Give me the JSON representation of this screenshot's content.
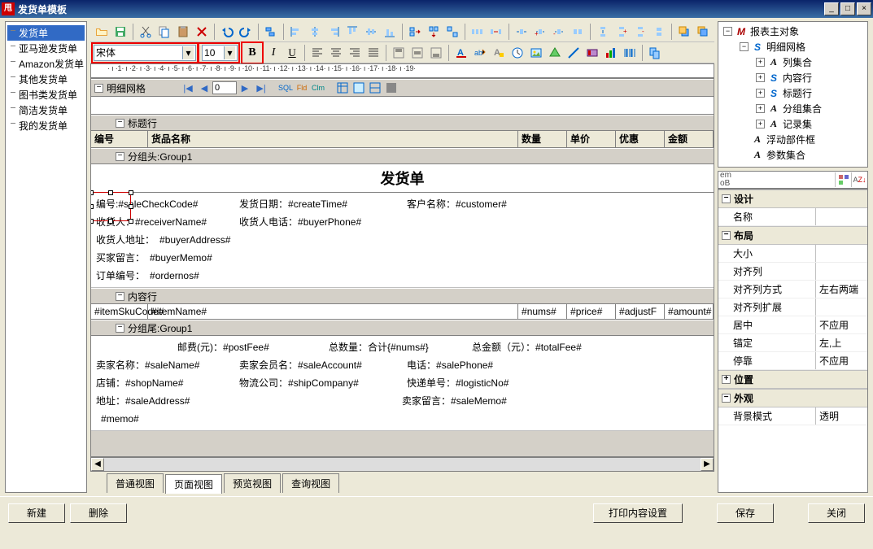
{
  "window": {
    "title": "发货单模板"
  },
  "leftTemplates": [
    "发货单",
    "亚马逊发货单",
    "Amazon发货单",
    "其他发货单",
    "图书类发货单",
    "简洁发货单",
    "我的发货单"
  ],
  "leftSelected": 0,
  "font": {
    "name": "宋体",
    "size": "10"
  },
  "rulerText": "· ı ·1· ı ·2· ı ·3· ı ·4· ı ·5· ı ·6· ı ·7· ı ·8· ı ·9· ı ·10· ı ·11· ı ·12· ı ·13· ı ·14· ı ·15· ı ·16· ı ·17· ı ·18· ı ·19·",
  "gridBar": {
    "label": "明细网格",
    "page": "0"
  },
  "sections": {
    "titleRow": "标题行",
    "groupHead": "分组头:Group1",
    "contentRow": "内容行",
    "groupFoot": "分组尾:Group1",
    "docTitle": "发货单"
  },
  "columns": {
    "no": "编号",
    "name": "货品名称",
    "qty": "数量",
    "price": "单价",
    "discount": "优惠",
    "amount": "金额"
  },
  "fields": {
    "line1": [
      {
        "label": "编号:",
        "val": "#saleCheckCode#"
      },
      {
        "label": "发货日期：",
        "val": "#createTime#"
      },
      {
        "label": "客户名称：",
        "val": "#customer#"
      }
    ],
    "line2": [
      {
        "label": "收货人：",
        "val": "#receiverName#"
      },
      {
        "label": "收货人电话：",
        "val": "#buyerPhone#"
      }
    ],
    "line3": [
      {
        "label": "收货人地址：",
        "val": "#buyerAddress#"
      }
    ],
    "line4": [
      {
        "label": "买家留言：",
        "val": "#buyerMemo#"
      }
    ],
    "line5": [
      {
        "label": "订单编号：",
        "val": "#ordernos#"
      }
    ],
    "content": [
      "#itemSkuCode#",
      "#itemName#",
      "#nums#",
      "#price#",
      "#adjustF",
      "#amount#"
    ],
    "foot1": [
      {
        "label": "邮费(元)：",
        "val": "#postFee#"
      },
      {
        "label": "总数量：",
        "val": "合计{#nums#}"
      },
      {
        "label": "总金额（元）：",
        "val": "#totalFee#"
      }
    ],
    "foot2": [
      {
        "label": "卖家名称：",
        "val": "#saleName#"
      },
      {
        "label": "卖家会员名：",
        "val": "#saleAccount#"
      },
      {
        "label": "电话：",
        "val": "#salePhone#"
      }
    ],
    "foot3": [
      {
        "label": "店铺：",
        "val": "#shopName#"
      },
      {
        "label": "物流公司：",
        "val": "#shipCompany#"
      },
      {
        "label": "快递单号：",
        "val": "#logisticNo#"
      }
    ],
    "foot4": [
      {
        "label": "地址：",
        "val": "#saleAddress#"
      },
      {
        "label": "卖家留言：",
        "val": "#saleMemo#"
      }
    ],
    "foot5": [
      {
        "label": "",
        "val": "#memo#"
      }
    ]
  },
  "midstrip": "#m\nem\noB\no#",
  "tree": {
    "root": {
      "glyph": "M",
      "label": "报表主对象"
    },
    "children": [
      {
        "glyph": "S",
        "label": "明细网格",
        "expanded": true,
        "children": [
          {
            "glyph": "A",
            "label": "列集合",
            "expandable": true
          },
          {
            "glyph": "S",
            "label": "内容行",
            "expandable": true
          },
          {
            "glyph": "S",
            "label": "标题行",
            "expandable": true
          },
          {
            "glyph": "A",
            "label": "分组集合",
            "expandable": true
          },
          {
            "glyph": "A",
            "label": "记录集",
            "expandable": true
          }
        ]
      },
      {
        "glyph": "A",
        "label": "浮动部件框"
      },
      {
        "glyph": "A",
        "label": "参数集合"
      }
    ]
  },
  "props": {
    "cats": [
      {
        "name": "设计",
        "rows": [
          [
            "名称",
            ""
          ]
        ]
      },
      {
        "name": "布局",
        "rows": [
          [
            "大小",
            ""
          ],
          [
            "对齐列",
            ""
          ],
          [
            "对齐列方式",
            "左右两端"
          ],
          [
            "对齐列扩展",
            ""
          ],
          [
            "居中",
            "不应用"
          ],
          [
            "锚定",
            "左,上"
          ],
          [
            "停靠",
            "不应用"
          ]
        ]
      },
      {
        "name": "位置",
        "rows": []
      },
      {
        "name": "外观",
        "rows": [
          [
            "背景模式",
            "透明"
          ]
        ]
      }
    ]
  },
  "tabs": [
    "普通视图",
    "页面视图",
    "预览视图",
    "查询视图"
  ],
  "activeTab": 1,
  "footer": {
    "new": "新建",
    "del": "删除",
    "printset": "打印内容设置",
    "save": "保存",
    "close": "关闭"
  }
}
